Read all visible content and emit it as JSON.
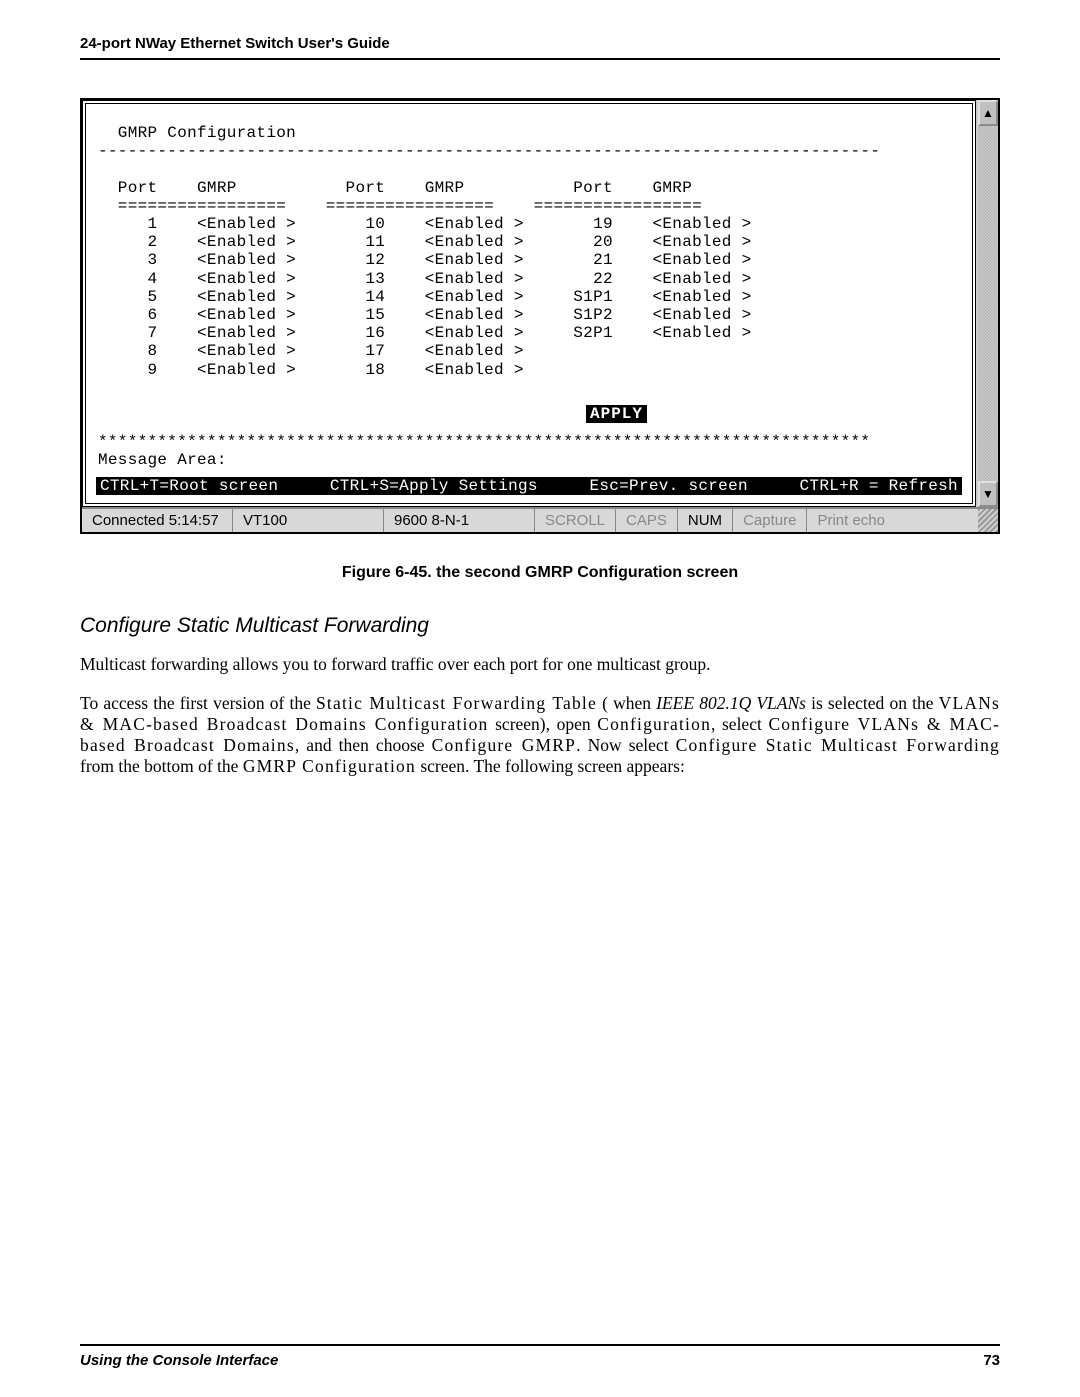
{
  "doc": {
    "header": "24-port NWay Ethernet Switch User's Guide",
    "footer_left": "Using the Console Interface",
    "footer_page": "73"
  },
  "terminal": {
    "title": "GMRP Configuration",
    "rule": "-------------------------------------------------------------------------------",
    "col_hdr_port": "Port",
    "col_hdr_gmrp": "GMRP",
    "col_sep": "=================",
    "columns": [
      {
        "rows": [
          {
            "port": "1",
            "gmrp": "<Enabled >"
          },
          {
            "port": "2",
            "gmrp": "<Enabled >"
          },
          {
            "port": "3",
            "gmrp": "<Enabled >"
          },
          {
            "port": "4",
            "gmrp": "<Enabled >"
          },
          {
            "port": "5",
            "gmrp": "<Enabled >"
          },
          {
            "port": "6",
            "gmrp": "<Enabled >"
          },
          {
            "port": "7",
            "gmrp": "<Enabled >"
          },
          {
            "port": "8",
            "gmrp": "<Enabled >"
          },
          {
            "port": "9",
            "gmrp": "<Enabled >"
          }
        ]
      },
      {
        "rows": [
          {
            "port": "10",
            "gmrp": "<Enabled >"
          },
          {
            "port": "11",
            "gmrp": "<Enabled >"
          },
          {
            "port": "12",
            "gmrp": "<Enabled >"
          },
          {
            "port": "13",
            "gmrp": "<Enabled >"
          },
          {
            "port": "14",
            "gmrp": "<Enabled >"
          },
          {
            "port": "15",
            "gmrp": "<Enabled >"
          },
          {
            "port": "16",
            "gmrp": "<Enabled >"
          },
          {
            "port": "17",
            "gmrp": "<Enabled >"
          },
          {
            "port": "18",
            "gmrp": "<Enabled >"
          }
        ]
      },
      {
        "rows": [
          {
            "port": "19",
            "gmrp": "<Enabled >"
          },
          {
            "port": "20",
            "gmrp": "<Enabled >"
          },
          {
            "port": "21",
            "gmrp": "<Enabled >"
          },
          {
            "port": "22",
            "gmrp": "<Enabled >"
          },
          {
            "port": "S1P1",
            "gmrp": "<Enabled >"
          },
          {
            "port": "S1P2",
            "gmrp": "<Enabled >"
          },
          {
            "port": "S2P1",
            "gmrp": "<Enabled >"
          }
        ]
      }
    ],
    "apply_label": "APPLY",
    "stars": "******************************************************************************",
    "message_area": "Message Area:",
    "hints": {
      "root": "CTRL+T=Root screen",
      "apply": "CTRL+S=Apply Settings",
      "prev": "Esc=Prev. screen",
      "refresh": "CTRL+R = Refresh"
    }
  },
  "status_bar": {
    "connected": "Connected 5:14:57",
    "emulation": "VT100",
    "serial": "9600 8-N-1",
    "scroll": "SCROLL",
    "caps": "CAPS",
    "num": "NUM",
    "capture": "Capture",
    "print_echo": "Print echo"
  },
  "caption": "Figure 6-45.  the second GMRP Configuration screen",
  "section_title": "Configure Static Multicast Forwarding",
  "paragraph1": "Multicast forwarding allows you to forward traffic over each port for one multicast group.",
  "paragraph2": {
    "lead": "To access the first version of the ",
    "menu1": "Static Multicast Forwarding Table",
    "t1": " when ",
    "em1": "IEEE 802.1Q VLANs",
    "t2": " is selected on the ",
    "menu2": "VLANs & MAC-based Broadcast Domains Configuration",
    "t3": " screen), open ",
    "menu3": "Configuration",
    "t4": ", select ",
    "menu4": "Configure VLANs & MAC-based Broadcast Domains",
    "t5": ", and then choose ",
    "menu5": "Configure GMRP",
    "t6": ". Now select ",
    "menu6": "Configure Static Multicast Forwarding",
    "t7": " from the bottom of the ",
    "menu7": "GMRP Configuration",
    "tail": " screen. The following screen appears:"
  }
}
